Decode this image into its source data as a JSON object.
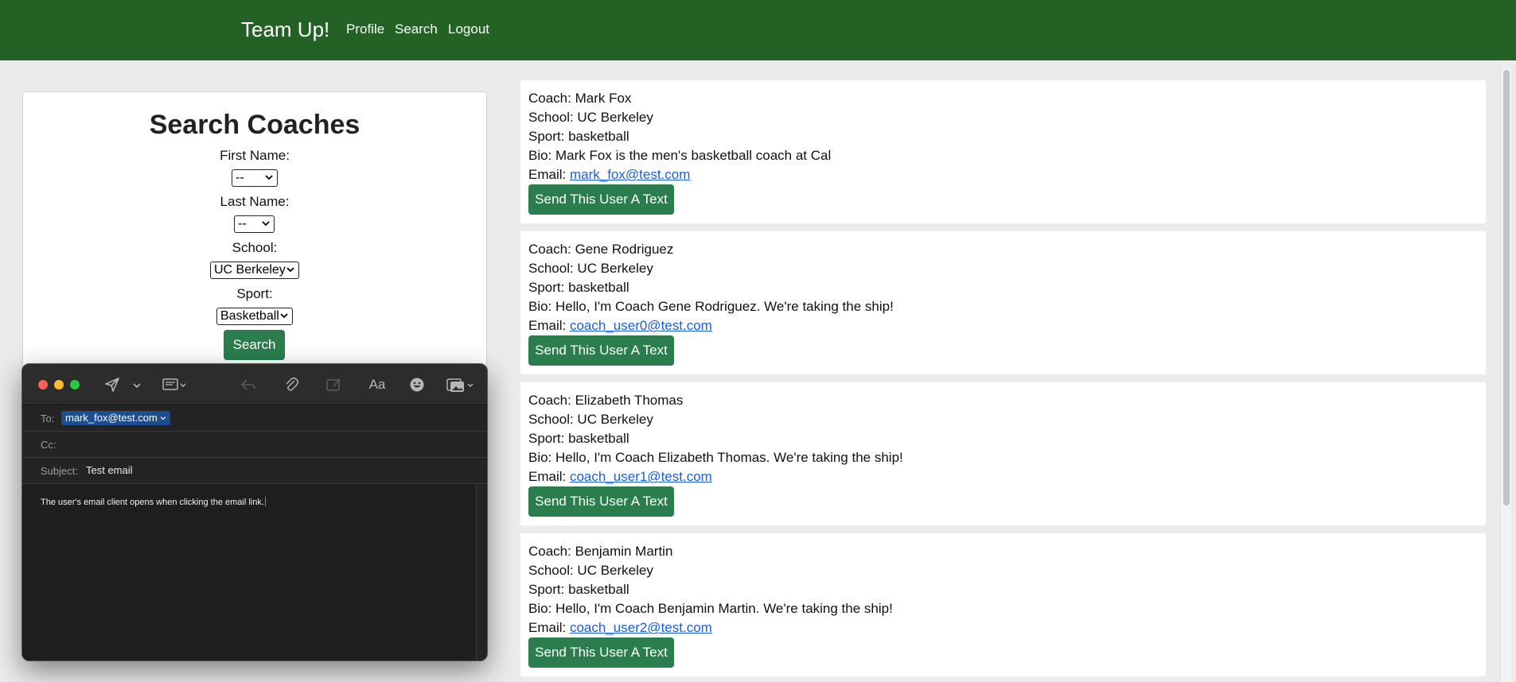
{
  "navbar": {
    "brand": "Team Up!",
    "links": [
      "Profile",
      "Search",
      "Logout"
    ],
    "background": "#236125"
  },
  "search": {
    "title": "Search Coaches",
    "fields": [
      {
        "label": "First Name:",
        "value": "--"
      },
      {
        "label": "Last Name:",
        "value": "--"
      },
      {
        "label": "School:",
        "value": "UC Berkeley"
      },
      {
        "label": "Sport:",
        "value": "Basketball"
      }
    ],
    "button": "Search"
  },
  "results": [
    {
      "coach": "Coach: Mark Fox",
      "school": "School: UC Berkeley",
      "sport": "Sport: basketball",
      "bio": "Bio: Mark Fox is the men's basketball coach at Cal",
      "email_label": "Email: ",
      "email": "mark_fox@test.com",
      "button": "Send This User A Text"
    },
    {
      "coach": "Coach: Gene Rodriguez",
      "school": "School: UC Berkeley",
      "sport": "Sport: basketball",
      "bio": "Bio: Hello, I'm Coach Gene Rodriguez. We're taking the ship!",
      "email_label": "Email: ",
      "email": "coach_user0@test.com",
      "button": "Send This User A Text"
    },
    {
      "coach": "Coach: Elizabeth Thomas",
      "school": "School: UC Berkeley",
      "sport": "Sport: basketball",
      "bio": "Bio: Hello, I'm Coach Elizabeth Thomas. We're taking the ship!",
      "email_label": "Email: ",
      "email": "coach_user1@test.com",
      "button": "Send This User A Text"
    },
    {
      "coach": "Coach: Benjamin Martin",
      "school": "School: UC Berkeley",
      "sport": "Sport: basketball",
      "bio": "Bio: Hello, I'm Coach Benjamin Martin. We're taking the ship!",
      "email_label": "Email: ",
      "email": "coach_user2@test.com",
      "button": "Send This User A Text"
    }
  ],
  "mail": {
    "to_label": "To:",
    "to_value": "mark_fox@test.com",
    "cc_label": "Cc:",
    "subject_label": "Subject:",
    "subject_value": "Test email",
    "body": "The user's email client opens when clicking the email link.",
    "font_button": "Aa"
  },
  "colors": {
    "accent_button": "#2b7d4e",
    "link": "#1a5fd8",
    "mail_bg": "#1e1e1e"
  }
}
